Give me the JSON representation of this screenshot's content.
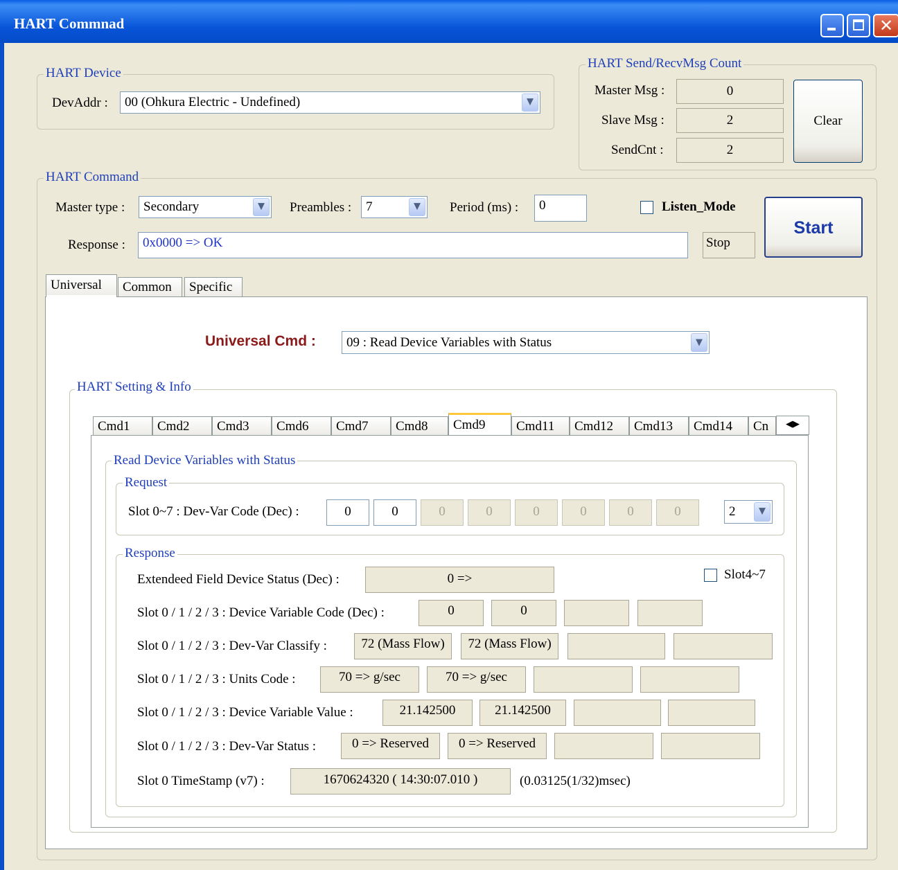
{
  "window": {
    "title": "HART Commnad"
  },
  "hart_device": {
    "group_label": "HART Device",
    "devaddr_label": "DevAddr :",
    "devaddr_value": "00  (Ohkura Electric - Undefined)"
  },
  "msg_count": {
    "group_label": "HART Send/RecvMsg Count",
    "master_label": "Master Msg :",
    "master_value": "0",
    "slave_label": "Slave Msg :",
    "slave_value": "2",
    "sendcnt_label": "SendCnt :",
    "sendcnt_value": "2",
    "clear_label": "Clear"
  },
  "hart_command": {
    "group_label": "HART Command",
    "master_type_label": "Master type :",
    "master_type_value": "Secondary",
    "preambles_label": "Preambles :",
    "preambles_value": "7",
    "period_label": "Period (ms) :",
    "period_value": "0",
    "listen_mode_label": "Listen_Mode",
    "start_label": "Start",
    "response_label": "Response :",
    "response_value": "0x0000 => OK",
    "stop_label": "Stop"
  },
  "tabs": [
    "Universal",
    "Common",
    "Specific"
  ],
  "universal": {
    "cmd_label": "Universal Cmd :",
    "cmd_value": "09 : Read Device Variables with Status",
    "setting_label": "HART Setting & Info"
  },
  "cmd_tabs": [
    "Cmd1",
    "Cmd2",
    "Cmd3",
    "Cmd6",
    "Cmd7",
    "Cmd8",
    "Cmd9",
    "Cmd11",
    "Cmd12",
    "Cmd13",
    "Cmd14",
    "Cn"
  ],
  "cmd9": {
    "group_label": "Read Device Variables with Status",
    "request": {
      "label": "Request",
      "slot_label": "Slot 0~7 : Dev-Var Code (Dec) :",
      "slots": [
        "0",
        "0",
        "0",
        "0",
        "0",
        "0",
        "0",
        "0"
      ],
      "count_value": "2"
    },
    "response": {
      "label": "Response",
      "ext_status_label": "Extendeed Field Device Status (Dec) :",
      "ext_status_value": "0 =>",
      "slot47_label": "Slot4~7",
      "var_code_label": "Slot 0 / 1 / 2 / 3 : Device Variable Code (Dec) :",
      "var_code": [
        "0",
        "0",
        "",
        ""
      ],
      "classify_label": "Slot 0 / 1 / 2 / 3 : Dev-Var Classify :",
      "classify": [
        "72 (Mass Flow)",
        "72 (Mass Flow)",
        "",
        ""
      ],
      "units_label": "Slot 0 / 1 / 2 / 3 : Units Code :",
      "units": [
        "70 => g/sec",
        "70 => g/sec",
        "",
        ""
      ],
      "value_label": "Slot 0 / 1 / 2 / 3 : Device Variable Value :",
      "values": [
        "21.142500",
        "21.142500",
        "",
        ""
      ],
      "status_label": "Slot 0 / 1 / 2 / 3 : Dev-Var Status :",
      "status": [
        "0 => Reserved",
        "0 => Reserved",
        "",
        ""
      ],
      "timestamp_label": "Slot 0 TimeStamp (v7) :",
      "timestamp_value": "1670624320  ( 14:30:07.010 )",
      "timestamp_unit": "(0.03125(1/32)msec)"
    }
  }
}
